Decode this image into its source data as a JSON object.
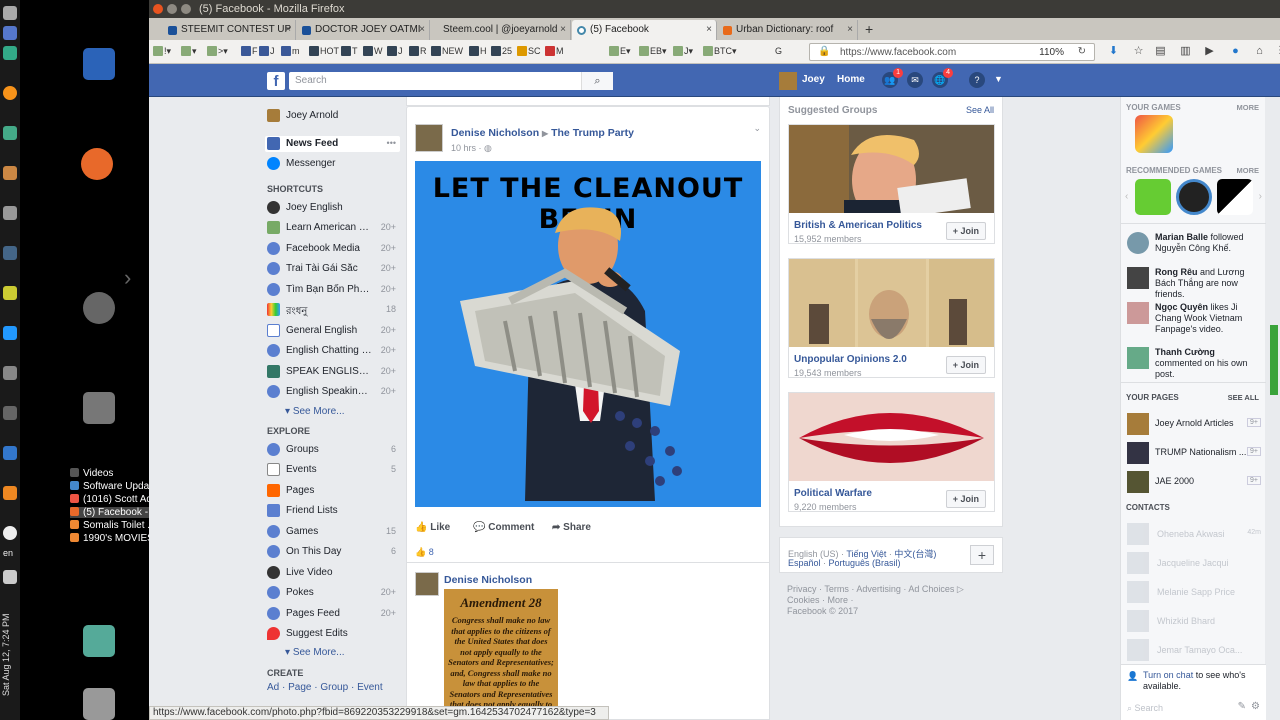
{
  "window": {
    "title": "(5) Facebook - Mozilla Firefox"
  },
  "tabs": [
    {
      "label": "STEEMIT CONTEST UP"
    },
    {
      "label": "DOCTOR JOEY OATMI"
    },
    {
      "label": "Steem.cool | @joeyarnold"
    },
    {
      "label": "(5) Facebook"
    },
    {
      "label": "Urban Dictionary: roof"
    }
  ],
  "bookmarks": [
    "F",
    "J",
    "m",
    "HOT",
    "T",
    "W",
    "J",
    "R",
    "NEW",
    "H",
    "25",
    "SC",
    "M",
    "E",
    "EB",
    "J",
    "BTC",
    "G"
  ],
  "url": {
    "value": "https://www.facebook.com",
    "zoom": "110%"
  },
  "status_url": "https://www.facebook.com/photo.php?fbid=869220353229918&set=gm.1642534702477162&type=3",
  "desktop": {
    "clock": "Sat Aug 12, 7:24 PM",
    "lang": "en",
    "tasks": [
      "Videos",
      "Software Upda...",
      "(1016) Scott Ad...",
      "(5) Facebook - ...",
      "Somalis Toilet ...",
      "1990's MOVIES"
    ]
  },
  "header": {
    "search_placeholder": "Search",
    "user": "Joey",
    "home": "Home",
    "badge_friends": "1",
    "badge_notif": "4"
  },
  "left_nav": {
    "profile": "Joey Arnold",
    "news_feed": "News Feed",
    "messenger": "Messenger",
    "shortcuts_title": "SHORTCUTS",
    "shortcuts": [
      {
        "label": "Joey English",
        "count": ""
      },
      {
        "label": "Learn American Engli...",
        "count": "20+"
      },
      {
        "label": "Facebook Media",
        "count": "20+"
      },
      {
        "label": "Trai Tài Gái Sắc",
        "count": "20+"
      },
      {
        "label": "Tìm Bạn Bốn Phương",
        "count": "20+"
      },
      {
        "label": "রংধনু",
        "count": "18"
      },
      {
        "label": "General English",
        "count": "20+"
      },
      {
        "label": "English Chatting Group",
        "count": "20+"
      },
      {
        "label": "SPEAK ENGLISH F...",
        "count": "20+"
      },
      {
        "label": "English Speaking Gr...",
        "count": "20+"
      }
    ],
    "see_more": "See More...",
    "explore_title": "EXPLORE",
    "explore": [
      {
        "label": "Groups",
        "count": "6"
      },
      {
        "label": "Events",
        "count": "5"
      },
      {
        "label": "Pages",
        "count": ""
      },
      {
        "label": "Friend Lists",
        "count": ""
      },
      {
        "label": "Games",
        "count": "15"
      },
      {
        "label": "On This Day",
        "count": "6"
      },
      {
        "label": "Live Video",
        "count": ""
      },
      {
        "label": "Pokes",
        "count": "20+"
      },
      {
        "label": "Pages Feed",
        "count": "20+"
      },
      {
        "label": "Suggest Edits",
        "count": ""
      }
    ],
    "see_more2": "See More...",
    "create_title": "CREATE",
    "create": [
      "Ad",
      "Page",
      "Group",
      "Event"
    ]
  },
  "post1": {
    "author": "Denise Nicholson",
    "group": "The Trump Party",
    "time": "10 hrs",
    "image_text": "LET THE CLEANOUT BEGIN",
    "like": "Like",
    "comment": "Comment",
    "share": "Share",
    "reactions": "8"
  },
  "post2": {
    "author": "Denise Nicholson",
    "image_title": "Amendment 28",
    "image_body": "Congress shall make no law that applies to the citizens of the United States that does not apply equally to the Senators and Representatives; and, Congress shall make no law that applies to the Senators and Representatives that does not apply equally to the"
  },
  "suggested": {
    "title": "Suggested Groups",
    "see_all": "See All",
    "join": "Join",
    "groups": [
      {
        "name": "British & American Politics",
        "members": "15,952 members"
      },
      {
        "name": "Unpopular Opinions 2.0",
        "members": "19,543 members"
      },
      {
        "name": "Political Warfare",
        "members": "9,220 members"
      }
    ]
  },
  "languages": {
    "current": "English (US)",
    "l1": "Tiếng Việt",
    "l2": "中文(台灣)",
    "l3": "Español",
    "l4": "Português (Brasil)"
  },
  "footer": {
    "line1": "Privacy · Terms · Advertising · Ad Choices",
    "line2": "Cookies · More ·",
    "line3": "Facebook © 2017"
  },
  "right_rail": {
    "your_games": "YOUR GAMES",
    "more": "MORE",
    "recommended": "RECOMMENDED GAMES",
    "ticker": [
      {
        "bold": "Marian Balle",
        "rest": " followed Nguyễn Công Khế."
      },
      {
        "bold": "Rong Rêu",
        "rest": " and Lương Bách Thắng are now friends."
      },
      {
        "bold": "Ngọc Quyên",
        "rest": " likes Ji Chang Wook Vietnam Fanpage's video."
      },
      {
        "bold": "Thanh Cường",
        "rest": " commented on his own post."
      }
    ],
    "your_pages": "YOUR PAGES",
    "see_all": "SEE ALL",
    "pages": [
      {
        "name": "Joey Arnold Articles",
        "count": "9+"
      },
      {
        "name": "TRUMP Nationalism ...",
        "count": "9+"
      },
      {
        "name": "JAE 2000",
        "count": "9+"
      }
    ],
    "contacts_title": "CONTACTS",
    "contacts": [
      {
        "name": "Oheneba Akwasi",
        "meta": "42m"
      },
      {
        "name": "Jacqueline Jacqui",
        "meta": ""
      },
      {
        "name": "Melanie Sapp Price",
        "meta": ""
      },
      {
        "name": "Whizkid Bhard",
        "meta": ""
      },
      {
        "name": "Jemar Tamayo Oca...",
        "meta": ""
      }
    ],
    "chat_link": "Turn on chat",
    "chat_text": " to see who's available.",
    "search_placeholder": "Search"
  }
}
